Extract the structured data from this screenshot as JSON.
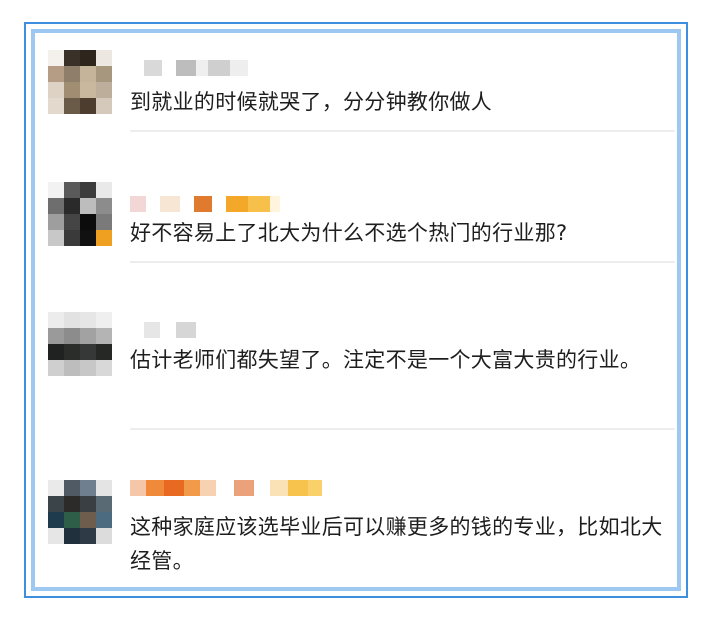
{
  "comments": [
    {
      "text": "到就业的时候就哭了，分分钟教你做人",
      "avatar_icon": "blurred-avatar",
      "name_icon": "blurred-username"
    },
    {
      "text": "好不容易上了北大为什么不选个热门的行业那?",
      "avatar_icon": "blurred-avatar",
      "name_icon": "blurred-username"
    },
    {
      "text": "估计老师们都失望了。注定不是一个大富大贵的行业。",
      "avatar_icon": "blurred-avatar",
      "name_icon": "blurred-username"
    },
    {
      "text": "这种家庭应该选毕业后可以赚更多的钱的专业，比如北大经管。",
      "avatar_icon": "blurred-avatar",
      "name_icon": "blurred-username"
    }
  ],
  "colors": {
    "frame_outer": "#3f8fe0",
    "frame_inner": "#9cc8f1",
    "text": "#1e1e1e",
    "divider": "#ededed"
  }
}
